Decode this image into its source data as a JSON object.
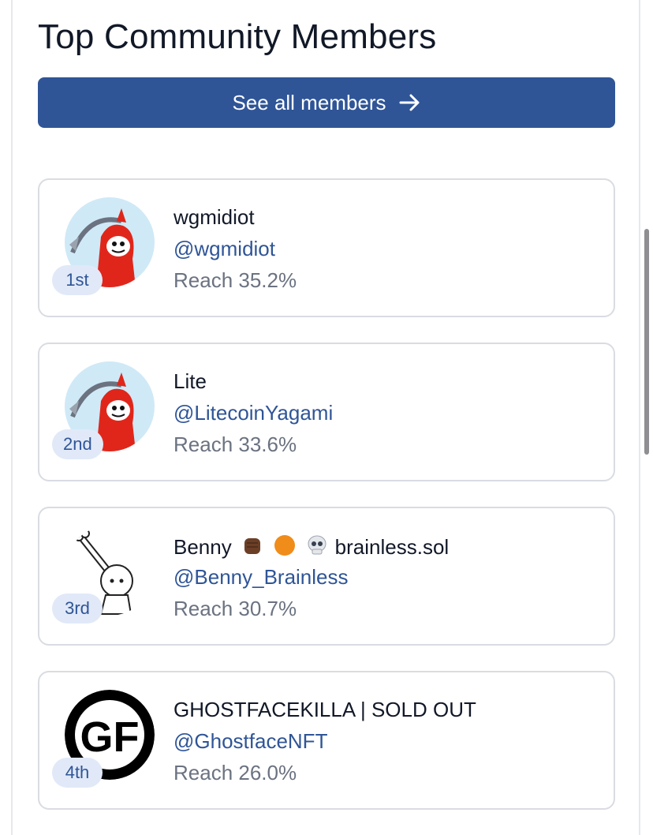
{
  "header": {
    "title": "Top Community Members"
  },
  "see_all": {
    "label": "See all members"
  },
  "members": [
    {
      "rank": "1st",
      "name": "wgmidiot",
      "handle": "@wgmidiot",
      "reach": "Reach 35.2%",
      "avatar": "reaper-avatar"
    },
    {
      "rank": "2nd",
      "name": "Lite",
      "handle": "@LitecoinYagami",
      "reach": "Reach 33.6%",
      "avatar": "reaper-avatar"
    },
    {
      "rank": "3rd",
      "name_prefix": "Benny",
      "name_emojis": [
        "fist-emoji",
        "orange-circle-emoji",
        "skull-emoji"
      ],
      "name_suffix": "brainless.sol",
      "handle": "@Benny_Brainless",
      "reach": "Reach 30.7%",
      "avatar": "skeleton-avatar"
    },
    {
      "rank": "4th",
      "name": "GHOSTFACEKILLA | SOLD OUT",
      "handle": "@GhostfaceNFT",
      "reach": "Reach 26.0%",
      "avatar": "gf-logo-avatar"
    }
  ]
}
